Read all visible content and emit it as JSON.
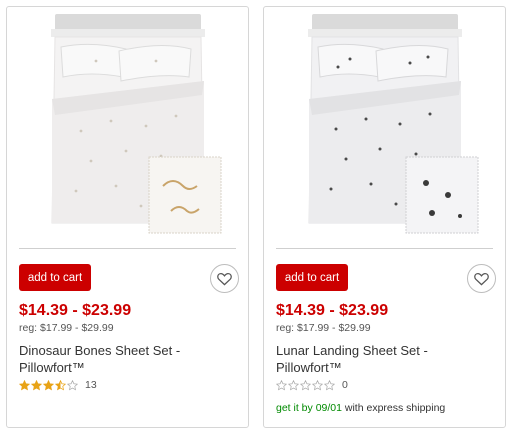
{
  "products": [
    {
      "add_label": "add to cart",
      "price": "$14.39 - $23.99",
      "reg": "reg: $17.99 - $29.99",
      "title": "Dinosaur Bones Sheet Set - Pillowfort™",
      "rating": 3.5,
      "rating_count": "13"
    },
    {
      "add_label": "add to cart",
      "price": "$14.39 - $23.99",
      "reg": "reg: $17.99 - $29.99",
      "title": "Lunar Landing Sheet Set - Pillowfort™",
      "rating": 0,
      "rating_count": "0",
      "shipping_prefix": "get it by 09/01",
      "shipping_suffix": " with express shipping"
    }
  ],
  "icons": {
    "favorite": "heart-icon",
    "rating": "star-icon"
  },
  "colors": {
    "accent": "#cc0000",
    "star": "#e8a317",
    "shipping": "#008a00"
  }
}
